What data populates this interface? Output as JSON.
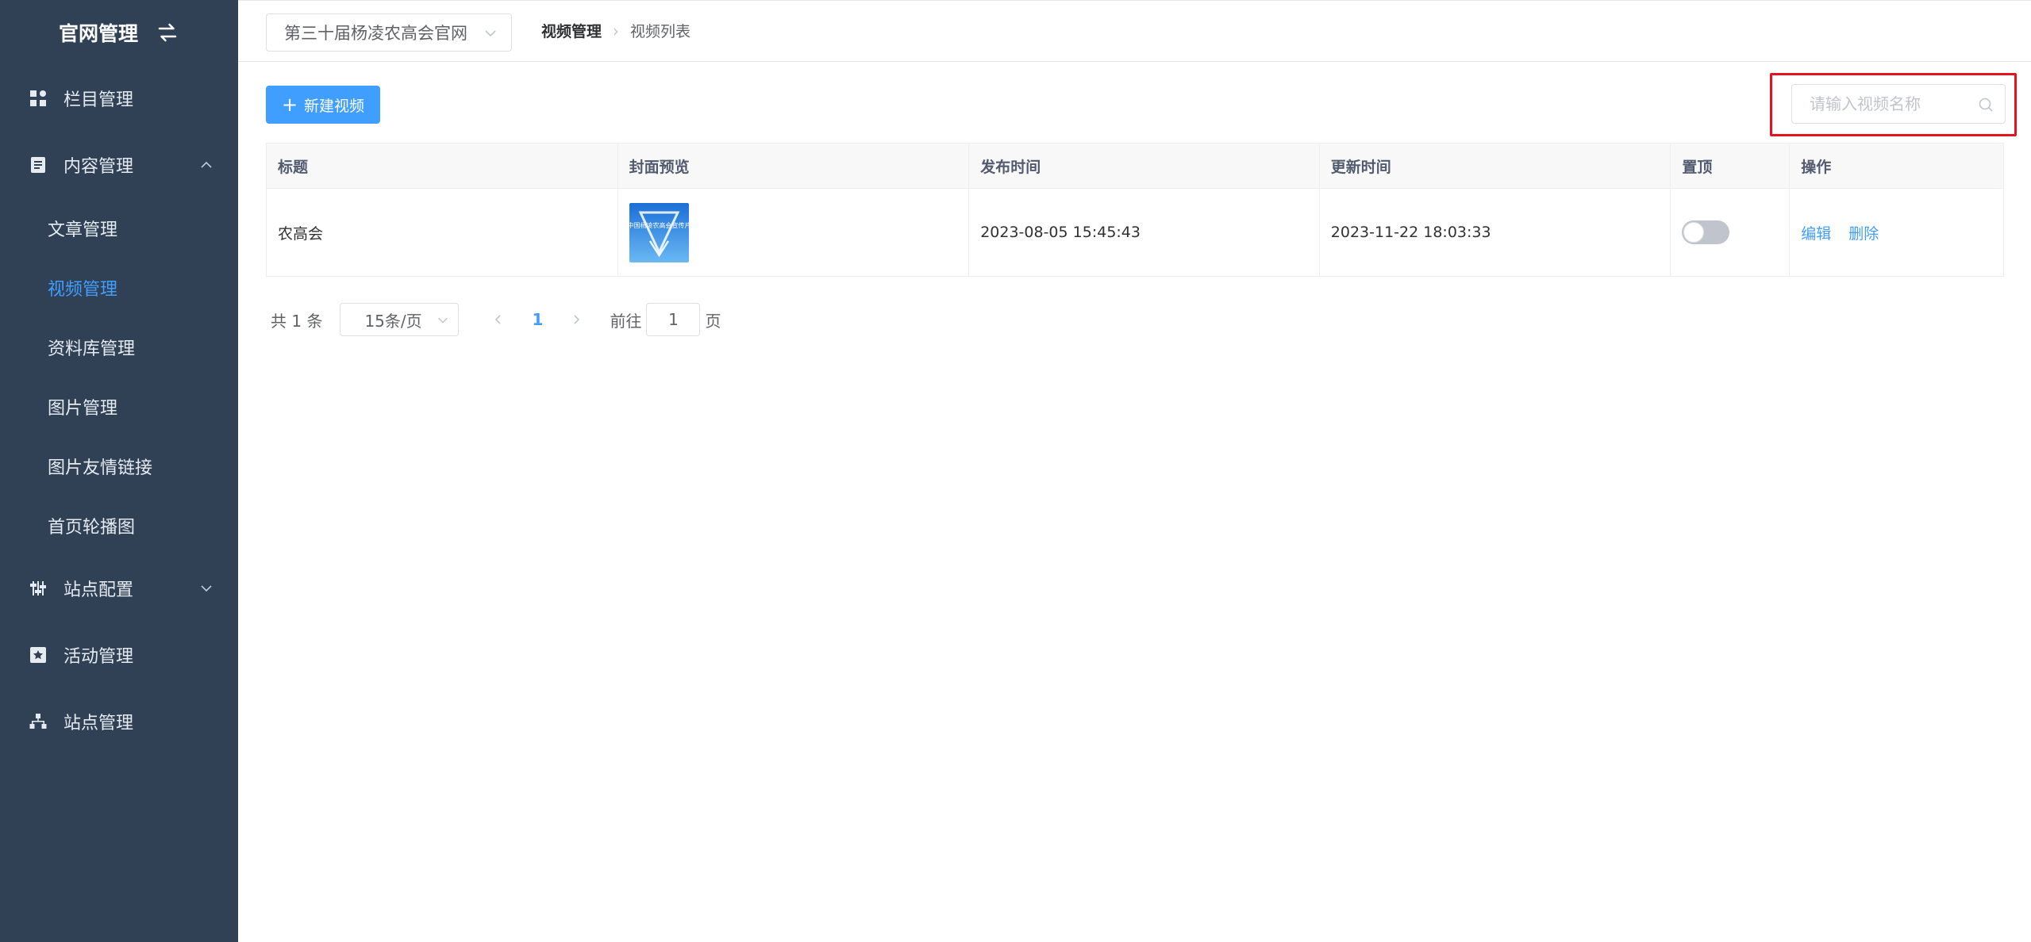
{
  "sidebar": {
    "title": "官网管理",
    "menu": [
      {
        "label": "栏目管理"
      },
      {
        "label": "内容管理"
      },
      {
        "label": "站点配置"
      },
      {
        "label": "活动管理"
      },
      {
        "label": "站点管理"
      }
    ],
    "content_submenu": [
      {
        "label": "文章管理"
      },
      {
        "label": "视频管理",
        "active": true
      },
      {
        "label": "资料库管理"
      },
      {
        "label": "图片管理"
      },
      {
        "label": "图片友情链接"
      },
      {
        "label": "首页轮播图"
      }
    ]
  },
  "topbar": {
    "site_select": "第三十届杨凌农高会官网",
    "breadcrumb": [
      "视频管理",
      "视频列表"
    ]
  },
  "toolbar": {
    "new_button": "新建视频",
    "search_placeholder": "请输入视频名称"
  },
  "table": {
    "columns": [
      "标题",
      "封面预览",
      "发布时间",
      "更新时间",
      "置顶",
      "操作"
    ],
    "rows": [
      {
        "title": "农高会",
        "publish_time": "2023-08-05 15:45:43",
        "update_time": "2023-11-22 18:03:33",
        "pinned": false,
        "actions": [
          "编辑",
          "删除"
        ],
        "cover_text": "中国杨凌农高会宣传片"
      }
    ]
  },
  "pagination": {
    "total": "共 1 条",
    "page_size": "15条/页",
    "current_page": "1",
    "goto_prefix": "前往",
    "goto_value": "1",
    "goto_suffix": "页"
  },
  "colors": {
    "sidebar_bg": "#304156",
    "primary": "#409eff",
    "highlight": "#e5131e"
  }
}
